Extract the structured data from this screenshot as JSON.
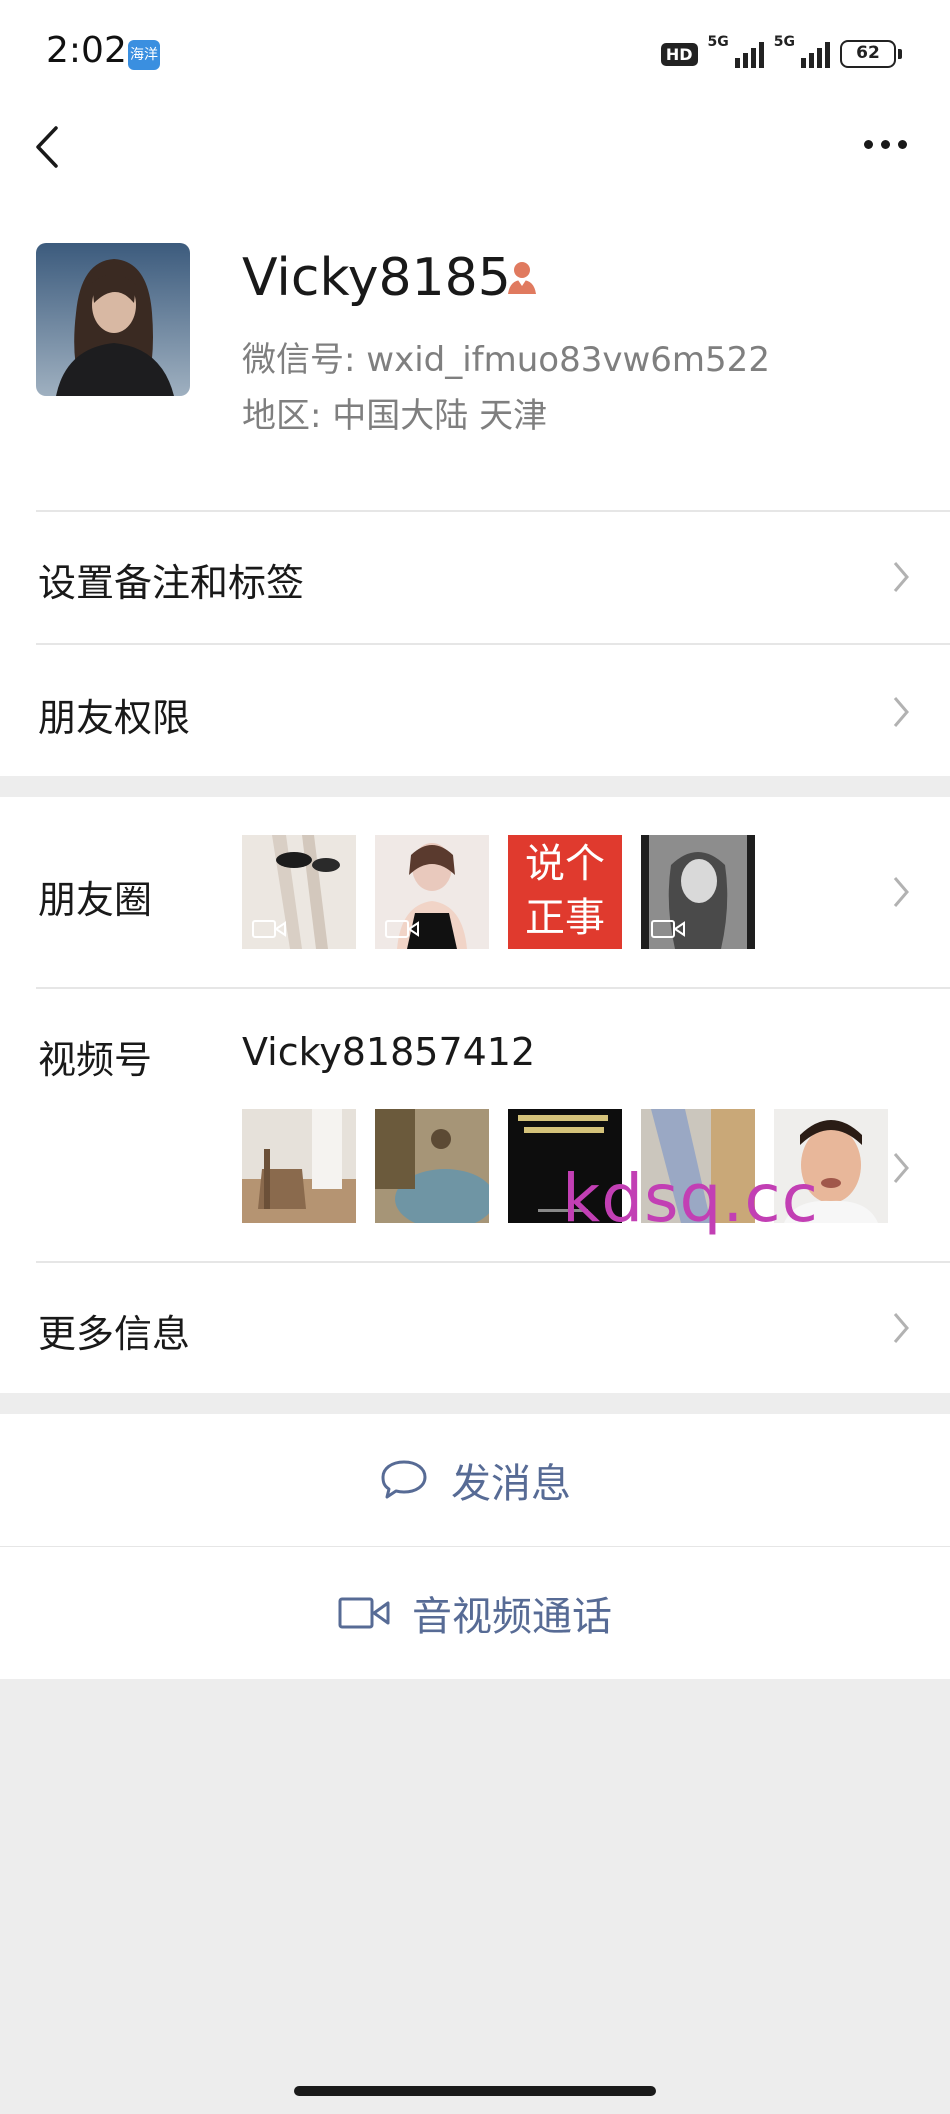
{
  "status_bar": {
    "time": "2:02",
    "app_badge": "海洋",
    "hd": "HD",
    "network1": "5G",
    "network2": "5G",
    "battery": "62"
  },
  "profile": {
    "name": "Vicky8185",
    "wxid_label": "微信号: ",
    "wxid": "wxid_ifmuo83vw6m522",
    "region_label": "地区: ",
    "region": "中国大陆  天津"
  },
  "menu": {
    "remark": "设置备注和标签",
    "permissions": "朋友权限",
    "moments": "朋友圈",
    "channels": "视频号",
    "channel_name": "Vicky81857412",
    "more_info": "更多信息"
  },
  "moments_thumbs": [
    {
      "name": "moment-thumb-1",
      "video": true
    },
    {
      "name": "moment-thumb-2",
      "video": true
    },
    {
      "name": "moment-thumb-3",
      "video": false,
      "text_line1": "说个",
      "text_line2": "正事"
    },
    {
      "name": "moment-thumb-4",
      "video": true
    }
  ],
  "watermark": "kdsq.cc",
  "actions": {
    "message": "发消息",
    "call": "音视频通话"
  },
  "icons": {
    "back": "back-chevron-icon",
    "more": "more-dots-icon",
    "gender": "female-person-icon",
    "chevron": "chevron-right-icon",
    "message": "chat-bubble-icon",
    "call": "video-camera-icon"
  },
  "colors": {
    "link_blue": "#576b95",
    "background": "#ededed",
    "gender_icon": "#e07a5f"
  }
}
